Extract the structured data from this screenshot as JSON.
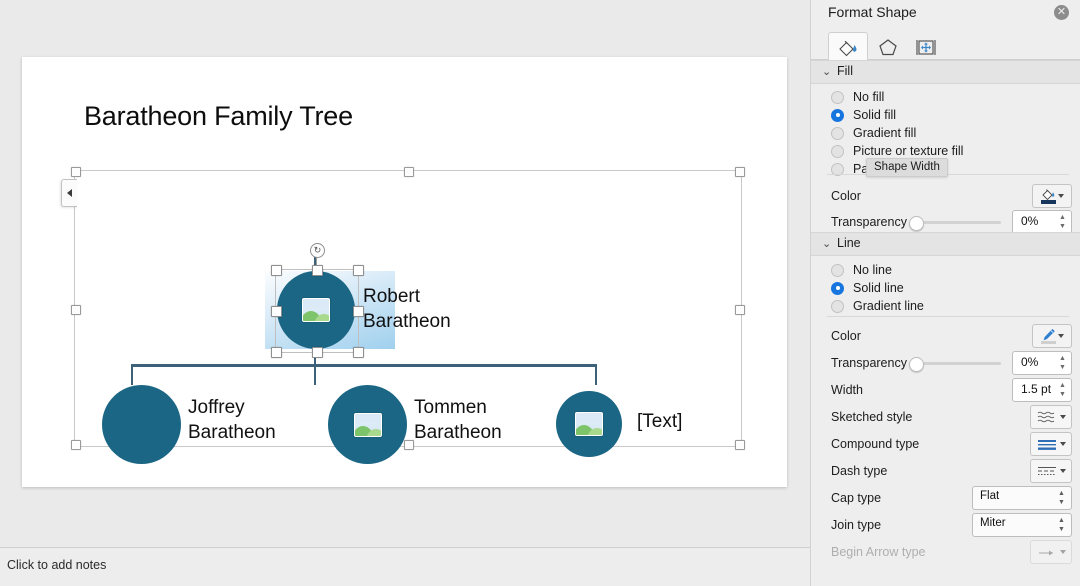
{
  "slide": {
    "title": "Baratheon Family Tree",
    "smartart": {
      "root": {
        "label": "Robert\nBaratheon",
        "has_picture_icon": true,
        "selected": true
      },
      "children": [
        {
          "label": "Joffrey\nBaratheon",
          "has_picture_icon": false
        },
        {
          "label": "Tommen\nBaratheon",
          "has_picture_icon": true
        },
        {
          "label": "[Text]",
          "has_picture_icon": true
        }
      ],
      "node_color": "#1a6684",
      "connector_color": "#3c6178",
      "text_bg_gradient_from": "#fbfdff",
      "text_bg_gradient_to": "#9fd0ee"
    }
  },
  "notes": {
    "placeholder": "Click to add notes"
  },
  "panel": {
    "title": "Format Shape",
    "close_icon": "✕",
    "tabs": [
      {
        "name": "fill-and-line",
        "icon": "paint-bucket-icon",
        "active": true
      },
      {
        "name": "effects",
        "icon": "pentagon-icon",
        "active": false
      },
      {
        "name": "size-and-properties",
        "icon": "layout-icon",
        "active": false
      }
    ],
    "fill": {
      "section_label": "Fill",
      "chevron": "⌄",
      "options": [
        {
          "label": "No fill",
          "selected": false
        },
        {
          "label": "Solid fill",
          "selected": true
        },
        {
          "label": "Gradient fill",
          "selected": false
        },
        {
          "label": "Picture or texture fill",
          "selected": false
        },
        {
          "label": "Pattern fill",
          "selected": false
        }
      ],
      "color_label": "Color",
      "color_icon": "paint-bucket-icon",
      "color_value": "#16365c",
      "transparency_label": "Transparency",
      "transparency_value": "0%"
    },
    "line": {
      "section_label": "Line",
      "chevron": "⌄",
      "options": [
        {
          "label": "No line",
          "selected": false
        },
        {
          "label": "Solid line",
          "selected": true
        },
        {
          "label": "Gradient line",
          "selected": false
        }
      ],
      "color_label": "Color",
      "color_icon": "pen-icon",
      "transparency_label": "Transparency",
      "transparency_value": "0%",
      "width_label": "Width",
      "width_value": "1.5 pt",
      "sketched_style_label": "Sketched style",
      "compound_type_label": "Compound type",
      "dash_type_label": "Dash type",
      "cap_type_label": "Cap type",
      "cap_type_value": "Flat",
      "join_type_label": "Join type",
      "join_type_value": "Miter",
      "begin_arrow_label": "Begin Arrow type"
    }
  },
  "tooltip": {
    "text": "Shape Width"
  }
}
